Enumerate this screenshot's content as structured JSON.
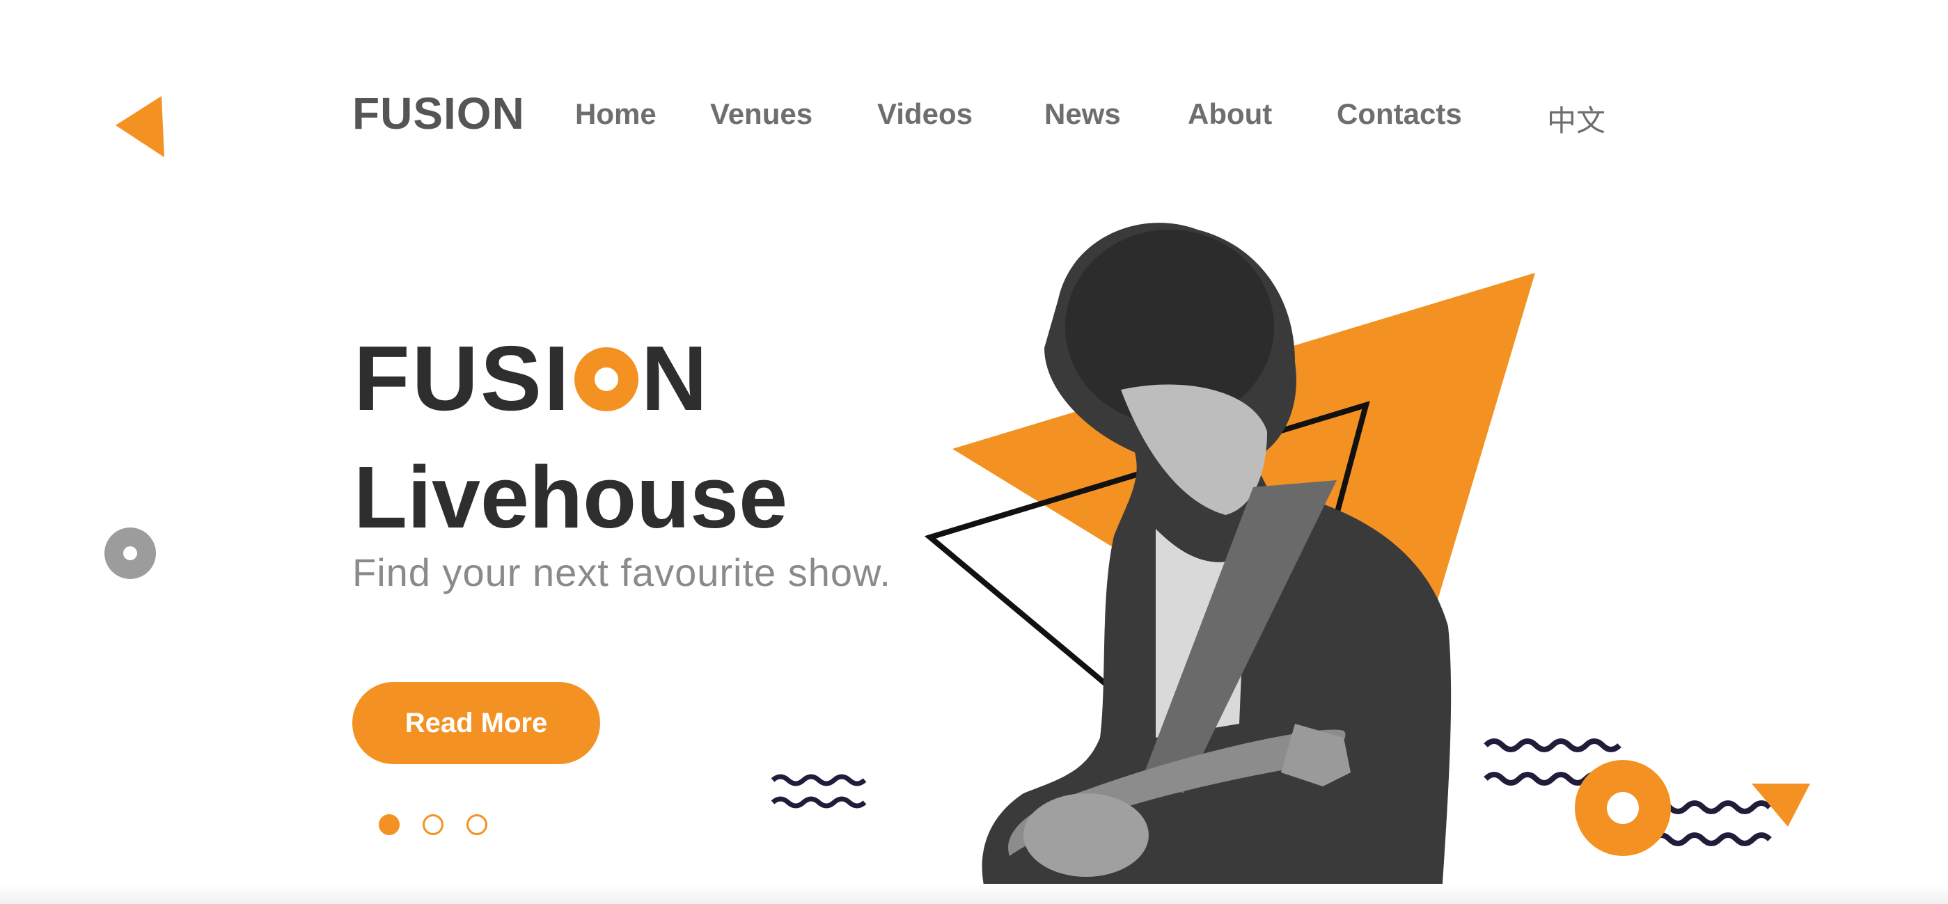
{
  "colors": {
    "accent": "#f39222",
    "text_dark": "#2e2e2e",
    "nav_text": "#6e6e6e",
    "muted": "#8a8a8a",
    "wave": "#1f1d3a"
  },
  "nav": {
    "back_icon": "triangle-left-icon",
    "logo": "FUSION",
    "items": [
      {
        "label": "Home"
      },
      {
        "label": "Venues"
      },
      {
        "label": "Videos"
      },
      {
        "label": "News"
      },
      {
        "label": "About"
      },
      {
        "label": "Contacts"
      },
      {
        "label": "中文"
      }
    ]
  },
  "hero": {
    "title_part1": "FUSI",
    "title_part2": "N",
    "title_line2": "Livehouse",
    "tagline": "Find your next favourite show.",
    "cta_label": "Read More",
    "slides": {
      "count": 3,
      "active_index": 0
    },
    "image": "guitarist-photo"
  }
}
